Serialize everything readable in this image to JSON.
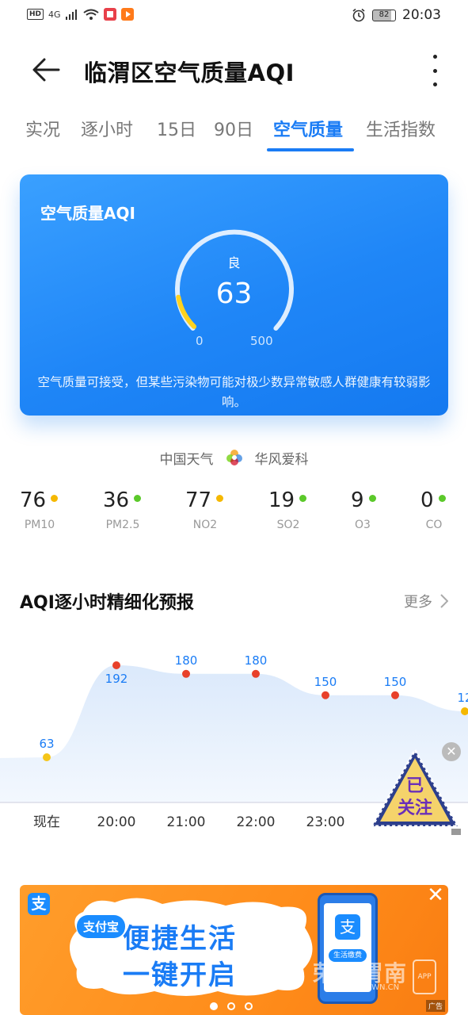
{
  "status_bar": {
    "hd": "HD",
    "network": "4G",
    "battery": "82",
    "time": "20:03"
  },
  "header": {
    "title": "临渭区空气质量AQI"
  },
  "tabs": [
    {
      "label": "实况",
      "active": false
    },
    {
      "label": "逐小时",
      "active": false
    },
    {
      "label": "15日",
      "active": false
    },
    {
      "label": "90日",
      "active": false
    },
    {
      "label": "空气质量",
      "active": true
    },
    {
      "label": "生活指数",
      "active": false
    }
  ],
  "aqi_card": {
    "title": "空气质量AQI",
    "level": "良",
    "value": "63",
    "min": "0",
    "max": "500",
    "fill_fraction": 0.126,
    "description": "空气质量可接受，但某些污染物可能对极少数异常敏感人群健康有较弱影响。"
  },
  "sources": {
    "provider": "中国天气",
    "partner": "华风爱科"
  },
  "pollutants": [
    {
      "value": "76",
      "name": "PM10",
      "color": "#f5b800"
    },
    {
      "value": "36",
      "name": "PM2.5",
      "color": "#5bc92a"
    },
    {
      "value": "77",
      "name": "NO2",
      "color": "#f5b800"
    },
    {
      "value": "19",
      "name": "SO2",
      "color": "#5bc92a"
    },
    {
      "value": "9",
      "name": "O3",
      "color": "#5bc92a"
    },
    {
      "value": "0",
      "name": "CO",
      "color": "#5bc92a"
    }
  ],
  "forecast": {
    "title": "AQI逐小时精细化预报",
    "more": "更多"
  },
  "chart_data": {
    "type": "area",
    "categories": [
      "现在",
      "20:00",
      "21:00",
      "22:00",
      "23:00",
      "",
      ""
    ],
    "values": [
      63,
      192,
      180,
      180,
      150,
      150,
      12
    ],
    "value_labels": [
      "63",
      "192",
      "180",
      "180",
      "150",
      "150",
      "12"
    ],
    "point_colors": [
      "#f5c518",
      "#e8402a",
      "#e8402a",
      "#e8402a",
      "#e8402a",
      "#e8402a",
      "#f5b800"
    ]
  },
  "follow_badge": {
    "line1": "已",
    "line2": "关注"
  },
  "ad": {
    "brand": "支付宝",
    "line1": "便捷生活",
    "line2": "一键开启",
    "phone_button": "生活缴费",
    "watermark": "荣耀渭南",
    "watermark_url": "WWW.YEWN.CN",
    "app_label": "APP",
    "tag": "广告",
    "logo_char": "支"
  }
}
